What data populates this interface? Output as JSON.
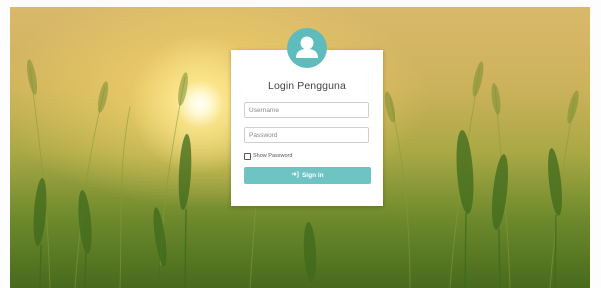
{
  "login": {
    "title": "Login Pengguna",
    "username_placeholder": "Username",
    "password_placeholder": "Password",
    "show_password_label": "Show Password",
    "show_password_checked": false,
    "sign_in_label": "Sign in",
    "sign_in_icon": "sign-in-icon"
  },
  "colors": {
    "accent": "#6ec3c3",
    "avatar": "#5fbcbc",
    "card": "#ffffff"
  },
  "icons": {
    "avatar": "user-icon",
    "sign_in": "sign-in-icon"
  }
}
